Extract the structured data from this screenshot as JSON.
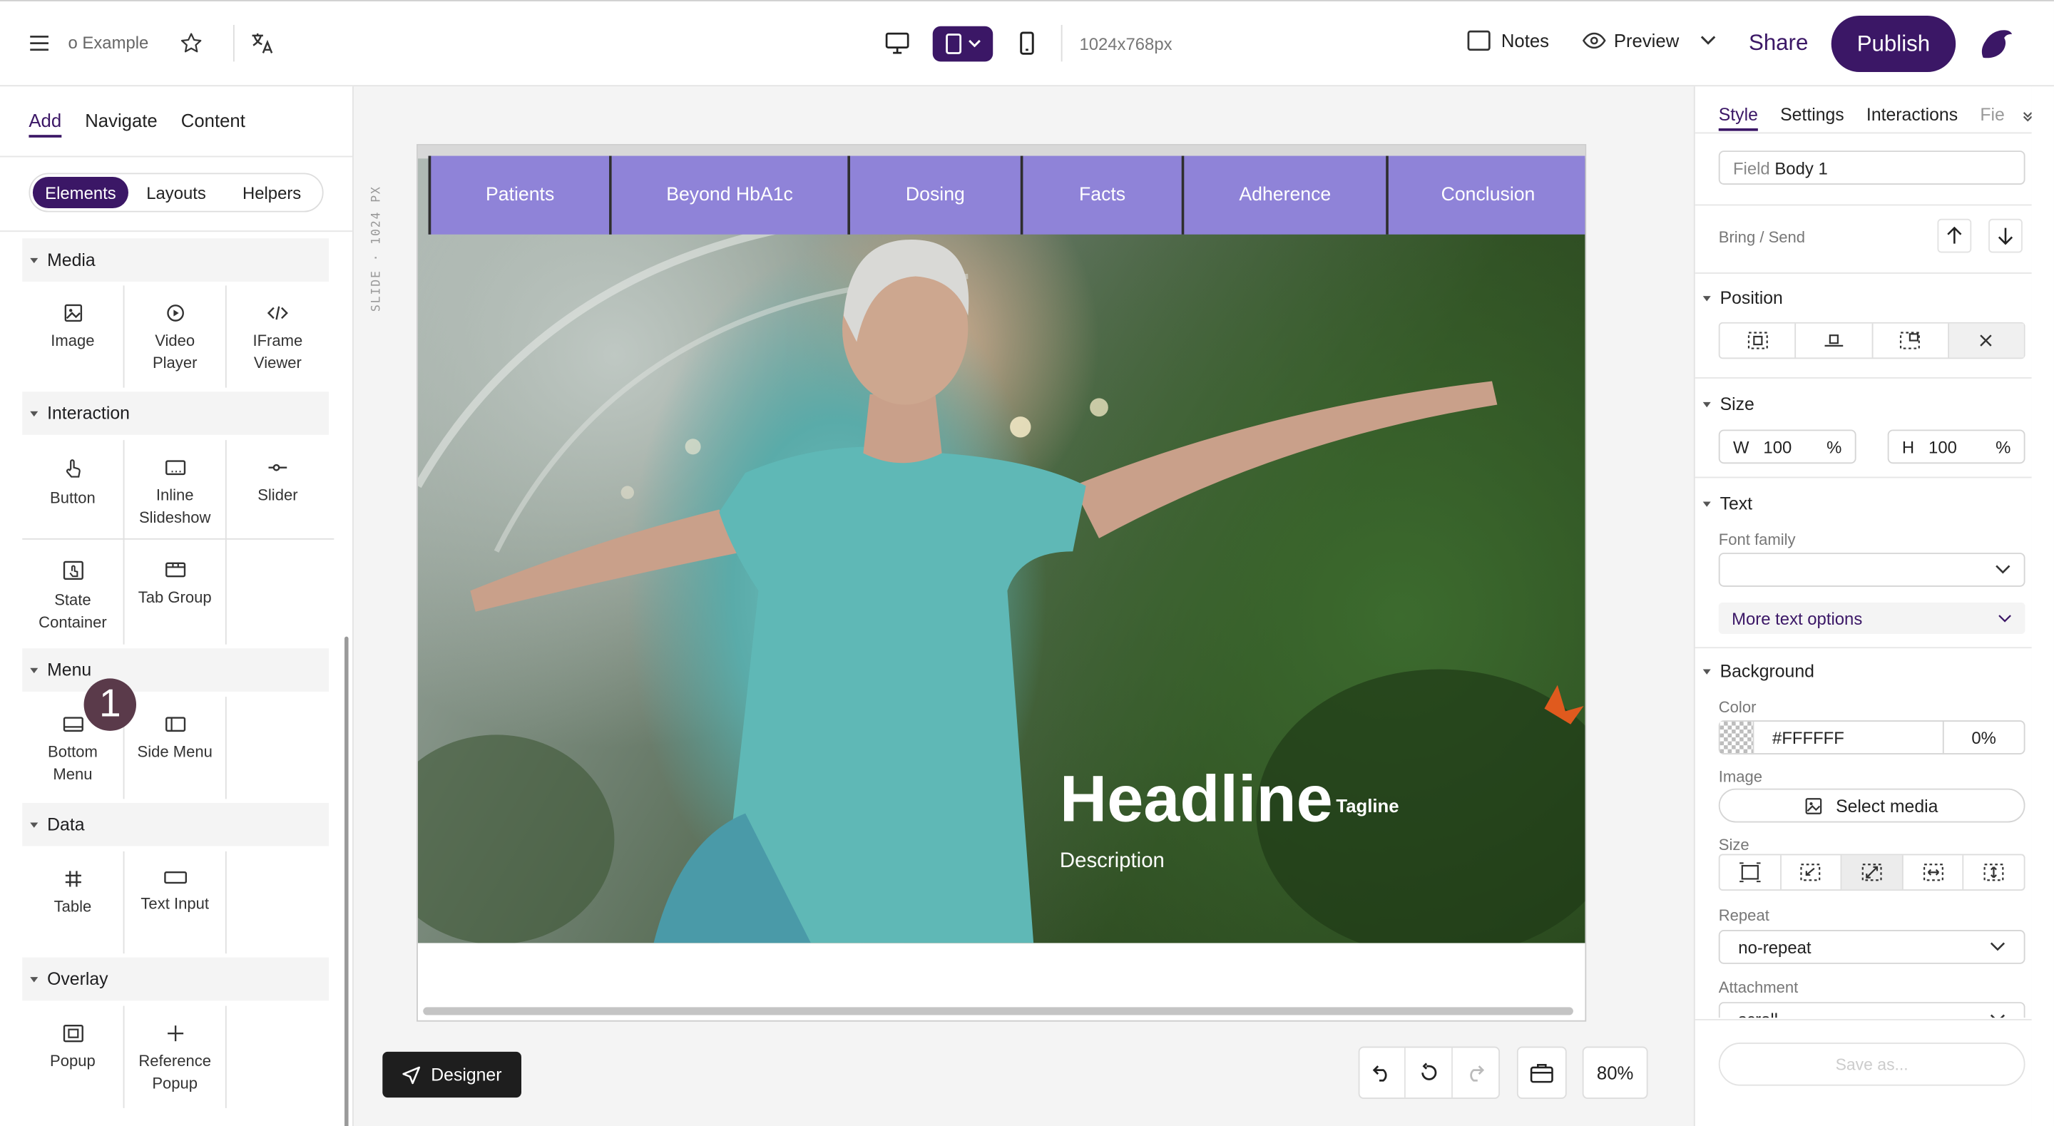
{
  "topbar": {
    "project_name": "o Example",
    "screen_size": "1024x768px",
    "notes_label": "Notes",
    "preview_label": "Preview",
    "share_label": "Share",
    "publish_label": "Publish"
  },
  "left_panel": {
    "tabs": [
      "Add",
      "Navigate",
      "Content"
    ],
    "active_tab": "Add",
    "segments": [
      "Elements",
      "Layouts",
      "Helpers"
    ],
    "active_segment": "Elements",
    "sections": {
      "media": {
        "title": "Media",
        "items": [
          "Image",
          "Video Player",
          "IFrame Viewer"
        ]
      },
      "interaction": {
        "title": "Interaction",
        "items": [
          "Button",
          "Inline Slideshow",
          "Slider",
          "State Container",
          "Tab Group"
        ]
      },
      "menu": {
        "title": "Menu",
        "items": [
          "Bottom Menu",
          "Side Menu"
        ]
      },
      "data": {
        "title": "Data",
        "items": [
          "Table",
          "Text Input"
        ]
      },
      "overlay": {
        "title": "Overlay",
        "items": [
          "Popup",
          "Reference Popup"
        ]
      }
    },
    "step_badge": "1"
  },
  "canvas": {
    "ruler_label": "SLIDE · 1024 PX",
    "nav_items": [
      "Patients",
      "Beyond HbA1c",
      "Dosing",
      "Facts",
      "Adherence",
      "Conclusion"
    ],
    "headline": "Headline",
    "tagline": "Tagline",
    "description": "Description",
    "designer_label": "Designer",
    "zoom": "80%"
  },
  "right_panel": {
    "tabs": [
      "Style",
      "Settings",
      "Interactions",
      "Fie"
    ],
    "active_tab": "Style",
    "field_prefix": "Field",
    "field_name": "Body 1",
    "bring_send_label": "Bring / Send",
    "position_title": "Position",
    "size_title": "Size",
    "width_label": "W",
    "width_value": "100",
    "width_unit": "%",
    "height_label": "H",
    "height_value": "100",
    "height_unit": "%",
    "text_title": "Text",
    "font_family_label": "Font family",
    "font_family_value": "",
    "more_text_options": "More text options",
    "background_title": "Background",
    "color_label": "Color",
    "color_value": "#FFFFFF",
    "opacity_value": "0%",
    "image_label": "Image",
    "select_media_label": "Select media",
    "bg_size_label": "Size",
    "repeat_label": "Repeat",
    "repeat_value": "no-repeat",
    "attachment_label": "Attachment",
    "attachment_value": "scroll",
    "save_as_label": "Save as..."
  },
  "colors": {
    "accent": "#3b1766",
    "nav_bg": "#8f83d8"
  }
}
